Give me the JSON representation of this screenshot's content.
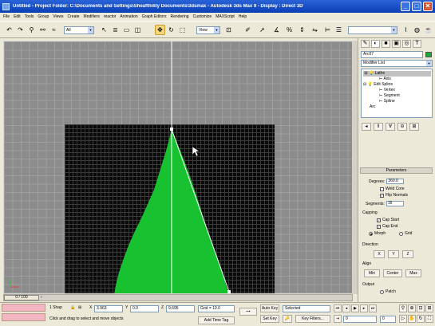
{
  "window": {
    "title": "Untitled    - Project Folder: C:\\Documents and Settings\\Sheafthility Documents\\3dsmax    - Autodesk 3ds Max 9         - Display : Direct 3D",
    "minimize": "_",
    "maximize": "□",
    "close": "✕"
  },
  "menu": [
    "File",
    "Edit",
    "Tools",
    "Group",
    "Views",
    "Create",
    "Modifiers",
    "reactor",
    "Animation",
    "Graph Editors",
    "Rendering",
    "Customize",
    "MAXScript",
    "Help"
  ],
  "toolbar": {
    "selection_filter": "All",
    "reference_coord": "View",
    "named_selection": ""
  },
  "viewport": {
    "label": ""
  },
  "command_panel": {
    "tabs": [
      "✎",
      "◐",
      "■",
      "▣",
      "◎",
      "T"
    ],
    "object_name": "Arc07",
    "modifier_list": "Modifier List",
    "stack": [
      {
        "label": "Lathe",
        "level": 0,
        "selected": true
      },
      {
        "label": "Axis",
        "level": 2,
        "selected": false
      },
      {
        "label": "Edit Spline",
        "level": 0,
        "selected": false
      },
      {
        "label": "Vertex",
        "level": 2,
        "selected": false
      },
      {
        "label": "Segment",
        "level": 2,
        "selected": false
      },
      {
        "label": "Spline",
        "level": 2,
        "selected": false
      },
      {
        "label": "Arc",
        "level": 0,
        "selected": false
      }
    ]
  },
  "parameters": {
    "title": "Parameters",
    "degrees_label": "Degrees:",
    "degrees_value": "360.0",
    "weld_core": "Weld Core",
    "flip_normals": "Flip Normals",
    "segments_label": "Segments:",
    "segments_value": "16",
    "capping_label": "Capping",
    "cap_start": "Cap Start",
    "cap_end": "Cap End",
    "morph": "Morph",
    "grid": "Grid",
    "direction_label": "Direction",
    "axis_x": "X",
    "axis_y": "Y",
    "axis_z": "Z",
    "align_label": "Align",
    "align_min": "Min",
    "align_center": "Center",
    "align_max": "Max",
    "output_label": "Output",
    "patch": "Patch"
  },
  "timeslider": {
    "label": "0 / 100"
  },
  "statusbar": {
    "selection_count": "1 Shap",
    "x_label": "X",
    "x_value": "3.963",
    "y_label": "Y",
    "y_value": "0.0",
    "z_label": "Z",
    "z_value": "9.695",
    "grid": "Grid = 10.0",
    "prompt": "Click and drag to select and move objects",
    "add_time_tag": "Add Time Tag",
    "auto_key": "Auto Key",
    "set_key": "Set Key",
    "key_mode": "Selected",
    "key_filters": "Key Filters...",
    "frame": "0",
    "spinner_c": "0"
  },
  "colors": {
    "shape_fill": "#17c12f",
    "frame_bg": "#0a0a0a",
    "viewport_grid": "#8c8c8c",
    "active_tool": "#f7d77a"
  }
}
